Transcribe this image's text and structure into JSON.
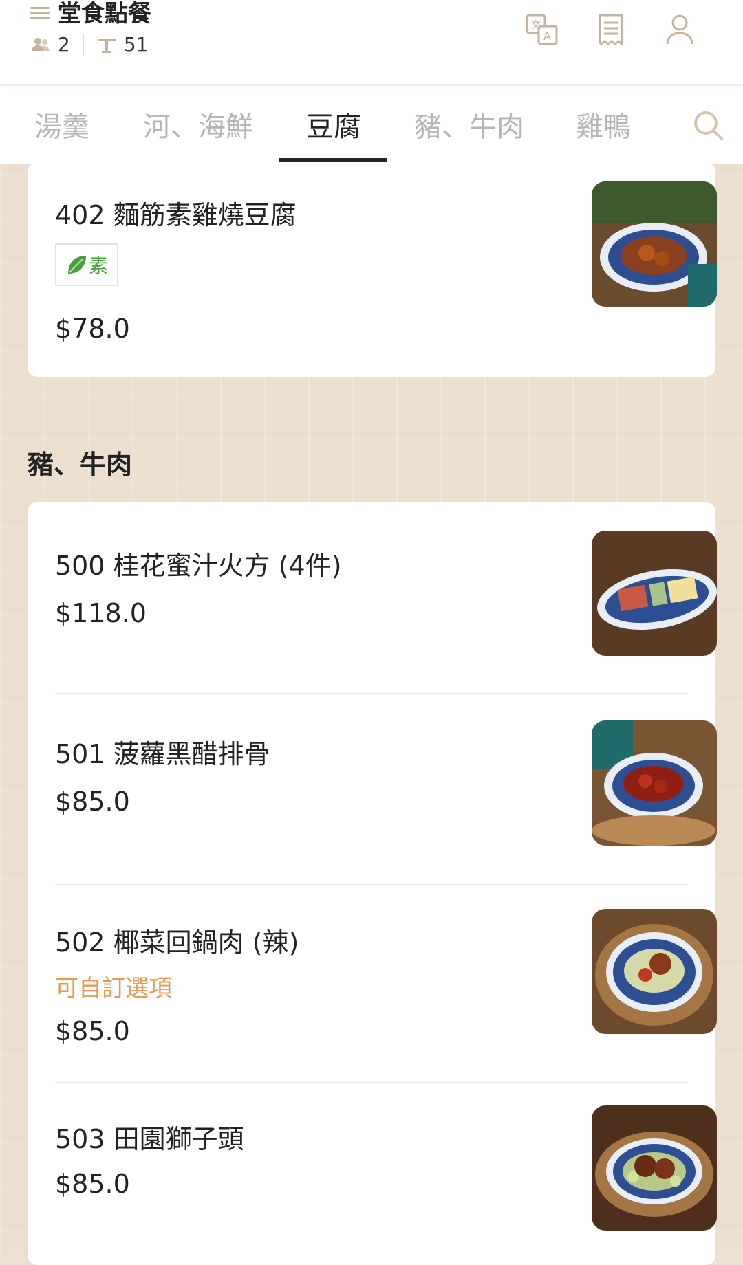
{
  "header": {
    "title": "堂食點餐",
    "guests": "2",
    "table": "51",
    "icons": [
      "menu-icon",
      "translate-icon",
      "receipt-icon",
      "user-icon"
    ]
  },
  "tabs": [
    {
      "label": "湯羹",
      "active": false
    },
    {
      "label": "河、海鮮",
      "active": false
    },
    {
      "label": "豆腐",
      "active": true
    },
    {
      "label": "豬、牛肉",
      "active": false
    },
    {
      "label": "雞鴨",
      "active": false
    }
  ],
  "tofu_items": [
    {
      "name": "402 麵筋素雞燒豆腐",
      "badge": "素",
      "price": "$78.0"
    }
  ],
  "section": {
    "title": "豬、牛肉"
  },
  "pork_items": [
    {
      "name": "500 桂花蜜汁火方 (4件)",
      "price": "$118.0"
    },
    {
      "name": "501 菠蘿黑醋排骨",
      "price": "$85.0"
    },
    {
      "name": "502 椰菜回鍋肉 (辣)",
      "option": "可自訂選項",
      "price": "$85.0"
    },
    {
      "name": "503 田園獅子頭",
      "price": "$85.0"
    }
  ],
  "colors": {
    "accent": "#e59a55",
    "veg": "#4a9e3e",
    "background": "#ecdfd0"
  }
}
